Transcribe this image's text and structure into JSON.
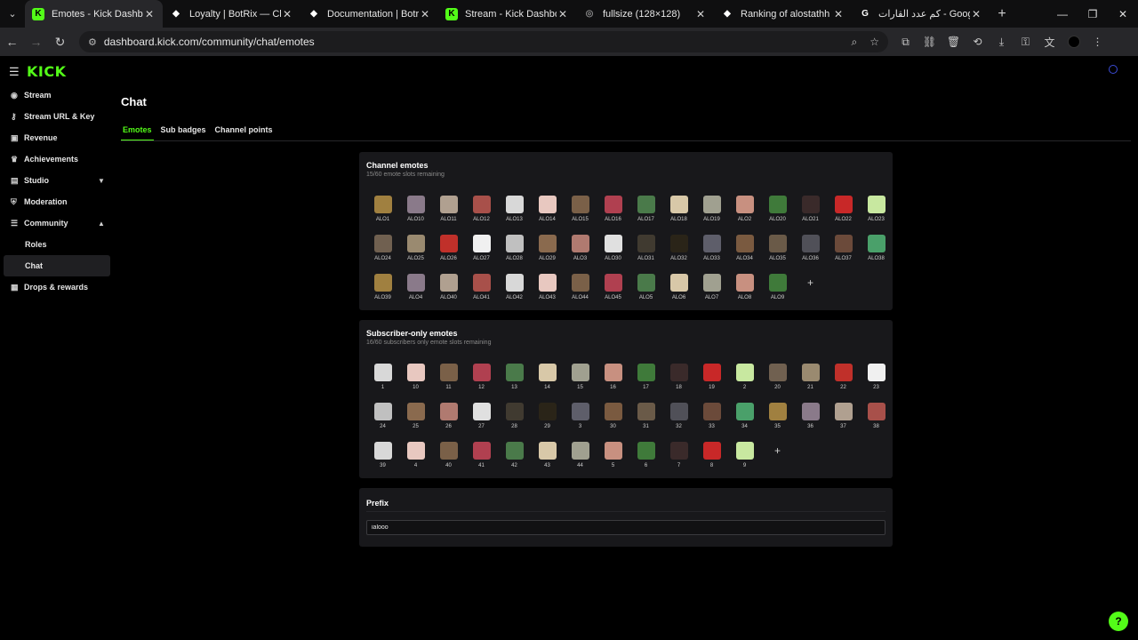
{
  "browser": {
    "tabs": [
      {
        "title": "Emotes - Kick Dashboard",
        "icon": "kick-icon",
        "active": true
      },
      {
        "title": "Loyalty | BotRix — Cloud",
        "icon": "botrix-icon",
        "active": false
      },
      {
        "title": "Documentation | Botrix",
        "icon": "botrix-icon",
        "active": false
      },
      {
        "title": "Stream - Kick Dashboard",
        "icon": "kick-icon",
        "active": false
      },
      {
        "title": "fullsize (128×128)",
        "icon": "globe-icon",
        "active": false
      },
      {
        "title": "Ranking of alostathh | Bot",
        "icon": "botrix-icon",
        "active": false
      },
      {
        "title": "كم عدد القارات - Google Search",
        "icon": "google-icon",
        "active": false
      }
    ],
    "url": "dashboard.kick.com/community/chat/emotes"
  },
  "sidebar": {
    "logo": "KICK",
    "items": [
      {
        "label": "Stream",
        "icon": "broadcast-icon"
      },
      {
        "label": "Stream URL & Key",
        "icon": "key-icon"
      },
      {
        "label": "Revenue",
        "icon": "dollar-icon"
      },
      {
        "label": "Achievements",
        "icon": "trophy-icon"
      },
      {
        "label": "Studio",
        "icon": "studio-icon",
        "chevron": "down"
      },
      {
        "label": "Moderation",
        "icon": "shield-icon"
      },
      {
        "label": "Community",
        "icon": "community-icon",
        "chevron": "up"
      }
    ],
    "subitems": [
      {
        "label": "Roles",
        "active": false
      },
      {
        "label": "Chat",
        "active": true
      }
    ],
    "last_item": {
      "label": "Drops & rewards",
      "icon": "gift-icon"
    }
  },
  "main": {
    "title": "Chat",
    "tabs": [
      {
        "label": "Emotes",
        "active": true
      },
      {
        "label": "Sub badges",
        "active": false
      },
      {
        "label": "Channel points",
        "active": false
      }
    ]
  },
  "channel_emotes": {
    "title": "Channel emotes",
    "subtitle": "15/60 emote slots remaining",
    "emotes": [
      "ALO1",
      "ALO10",
      "ALO11",
      "ALO12",
      "ALO13",
      "ALO14",
      "ALO15",
      "ALO16",
      "ALO17",
      "ALO18",
      "ALO19",
      "ALO2",
      "ALO20",
      "ALO21",
      "ALO22",
      "ALO23",
      "ALO24",
      "ALO25",
      "ALO26",
      "ALO27",
      "ALO28",
      "ALO29",
      "ALO3",
      "ALO30",
      "ALO31",
      "ALO32",
      "ALO33",
      "ALO34",
      "ALO35",
      "ALO36",
      "ALO37",
      "ALO38",
      "ALO39",
      "ALO4",
      "ALO40",
      "ALO41",
      "ALO42",
      "ALO43",
      "ALO44",
      "ALO45",
      "ALO5",
      "ALO6",
      "ALO7",
      "ALO8",
      "ALO9"
    ]
  },
  "sub_emotes": {
    "title": "Subscriber-only emotes",
    "subtitle": "16/60 subscribers only emote slots remaining",
    "emotes": [
      "1",
      "10",
      "11",
      "12",
      "13",
      "14",
      "15",
      "16",
      "17",
      "18",
      "19",
      "2",
      "20",
      "21",
      "22",
      "23",
      "24",
      "25",
      "26",
      "27",
      "28",
      "29",
      "3",
      "30",
      "31",
      "32",
      "33",
      "34",
      "35",
      "36",
      "37",
      "38",
      "39",
      "4",
      "40",
      "41",
      "42",
      "43",
      "44",
      "5",
      "6",
      "7",
      "8",
      "9"
    ]
  },
  "prefix": {
    "title": "Prefix",
    "value": "ialooo"
  },
  "colors": {
    "accent": "#53fc18",
    "panel": "#18181b",
    "background": "#000000"
  }
}
